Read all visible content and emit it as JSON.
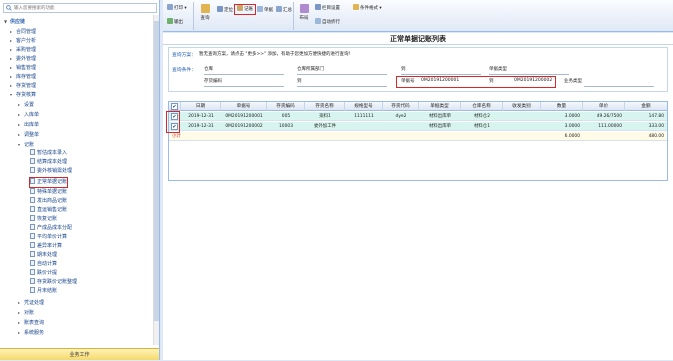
{
  "search": {
    "placeholder": "输入您要搜索的功能"
  },
  "tree": {
    "root": "供应链",
    "l1": [
      "合同管理",
      "客户分析",
      "采购管理",
      "委外管理",
      "销售管理",
      "库存管理",
      "存货管理",
      "存货核算"
    ],
    "l2": [
      "设置",
      "入库单",
      "出库单",
      "调整单",
      "记账"
    ],
    "l3": [
      "暂估成本录入",
      "结算成本处理",
      "委外核销需处理",
      "正常单据记账",
      "特殊单据记账",
      "发出商品记账",
      "直运销售记账",
      "恢复记账",
      "产成品成本分配",
      "平均单价计算",
      "差异率计算",
      "期末处理",
      "自动计算",
      "跌价计提",
      "存货跌价记账整理",
      "月末结账"
    ],
    "after": [
      "凭证处理",
      "对账",
      "账表查询",
      "系统服务"
    ],
    "footer": "业务工作"
  },
  "toolbar": {
    "print": "打印",
    "output": "输出",
    "query": "查询",
    "locate": "定位",
    "post": "记账",
    "voucher": "单据",
    "summary": "汇总",
    "layout": "布局",
    "column_settings": "栏目设置",
    "auto_fold": "自动折行",
    "format": "条件格式"
  },
  "page_title": "正常单据记账列表",
  "query": {
    "scheme_label": "查询方案：",
    "scheme_text": "暂无查询方案，请点击 \"更多>>\" 添加，有助于您更加方便快捷的进行查询！",
    "cond_label": "查询条件：",
    "warehouse": "仓库",
    "warehouse_dept": "仓库所属部门",
    "to1": "到",
    "doc_type": "单据类型",
    "inv_code": "存货编码",
    "to2": "到",
    "doc_no": "单据号",
    "doc_no_from": "0M20191200001",
    "to3": "到",
    "doc_no_to": "0M20191200002",
    "biz_type": "业务类型"
  },
  "grid": {
    "columns": [
      "",
      "日期",
      "单据号",
      "存货编码",
      "存货名称",
      "规格型号",
      "存货代码",
      "单据类型",
      "仓库名称",
      "收发类别",
      "数量",
      "单价",
      "金额"
    ],
    "rows": [
      {
        "checked": "✔",
        "date": "2019-12-31",
        "no": "0M20191200001",
        "code": "005",
        "name": "染料1",
        "spec": "1111111",
        "inv": "dye2",
        "type": "材料出库单",
        "wh": "材料仓2",
        "rs": "",
        "qty": "3.0000",
        "price": "49.26/7500",
        "amount": "147.80"
      },
      {
        "checked": "✔",
        "date": "2019-12-31",
        "no": "0M20191200002",
        "code": "10003",
        "name": "委外加工件",
        "spec": "",
        "inv": "",
        "type": "材料出库单",
        "wh": "材料仓1",
        "rs": "",
        "qty": "3.0000",
        "price": "111.00000",
        "amount": "333.00"
      }
    ],
    "total": {
      "label": "小计",
      "qty": "6.0000",
      "amount": "480.00"
    }
  }
}
